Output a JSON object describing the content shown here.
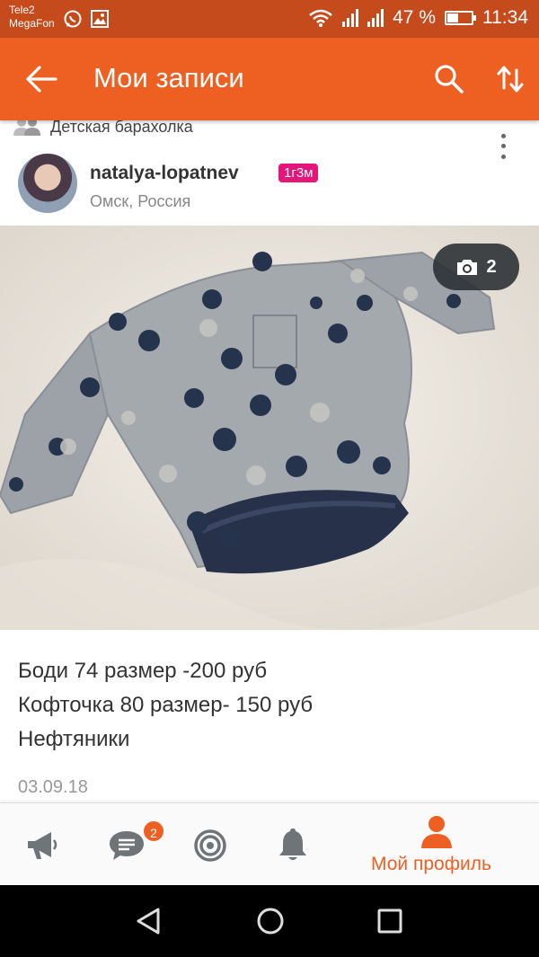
{
  "status_bar": {
    "carrier1": "Tele2",
    "carrier2": "MegaFon",
    "battery": "47 %",
    "battery_level": 0.47,
    "time": "11:34"
  },
  "app_bar": {
    "title": "Мои записи",
    "icons": [
      "back-arrow-icon",
      "search-icon",
      "sort-icon"
    ]
  },
  "post": {
    "group": "Детская барахолка",
    "author": "natalya-lopatnev",
    "badge": "1г3м",
    "location": "Омск, Россия",
    "photo_count": "2",
    "text_lines": [
      "Боди 74 размер -200 руб",
      "Кофточка 80 размер- 150 руб",
      "Нефтяники"
    ],
    "date": "03.09.18"
  },
  "tab_bar": {
    "tabs": [
      {
        "name": "announcements",
        "icon": "megaphone-icon"
      },
      {
        "name": "messages",
        "icon": "chat-icon",
        "badge": "2"
      },
      {
        "name": "target",
        "icon": "target-icon"
      },
      {
        "name": "notifications",
        "icon": "bell-icon"
      },
      {
        "name": "profile",
        "icon": "person-icon",
        "label": "Мой профиль",
        "active": true
      }
    ]
  },
  "colors": {
    "accent": "#ee5f22",
    "status_bar": "#c64b1c",
    "badge": "#e6157a"
  }
}
